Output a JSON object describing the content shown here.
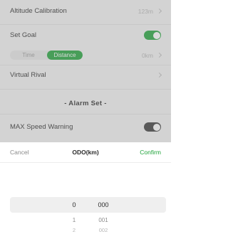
{
  "settings": {
    "altitude_label": "Altitude Calibration",
    "altitude_value": "123m",
    "goal_label": "Set Goal",
    "goal_enabled": true,
    "segment_time": "Time",
    "segment_distance": "Distance",
    "segment_selected": "Distance",
    "goal_value": "0km",
    "rival_label": "Virtual Rival",
    "alarm_title": "- Alarm Set -",
    "max_speed_label": "MAX Speed Warning",
    "max_speed_enabled": false
  },
  "picker": {
    "cancel_label": "Cancel",
    "title": "ODO(km)",
    "confirm_label": "Confirm",
    "left_column": [
      "0",
      "1",
      "2"
    ],
    "right_column": [
      "000",
      "001",
      "002"
    ]
  },
  "colors": {
    "accent": "#1fa33a"
  },
  "icons": [
    "chevron-right-icon"
  ]
}
